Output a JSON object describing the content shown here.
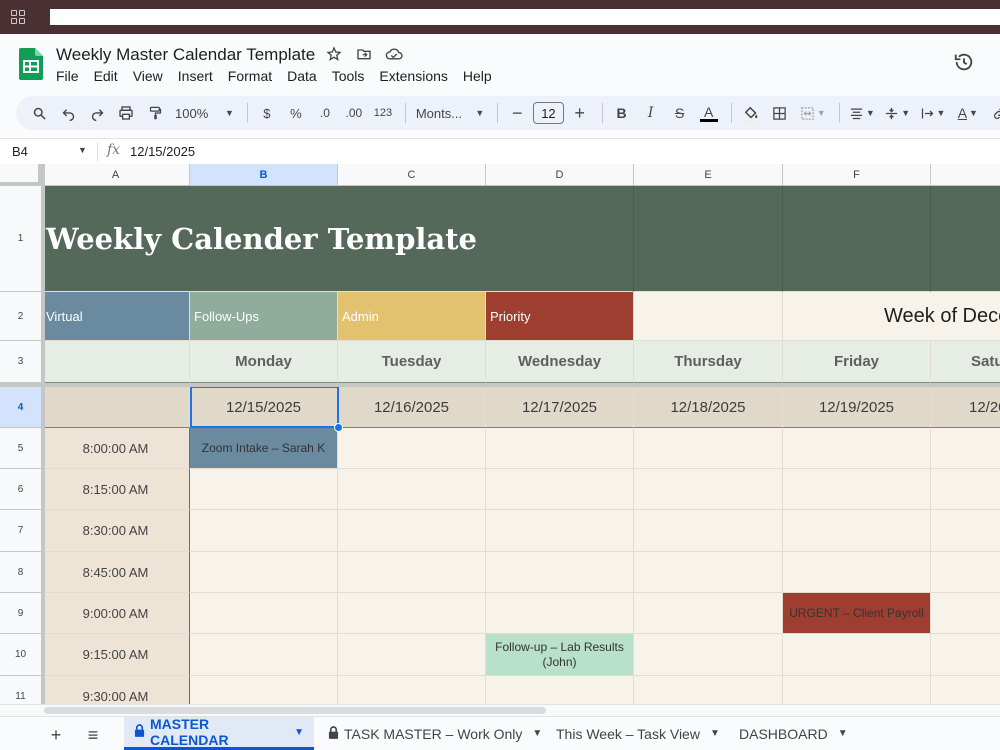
{
  "app": {
    "title": "Weekly Master Calendar Template",
    "menu": [
      "File",
      "Edit",
      "View",
      "Insert",
      "Format",
      "Data",
      "Tools",
      "Extensions",
      "Help"
    ]
  },
  "toolbar": {
    "zoom": "100%",
    "currency": "$",
    "percent": "%",
    "dec_decrease": ".0",
    "dec_increase": ".00",
    "number_format": "123",
    "font": "Monts...",
    "font_size": "12",
    "bold": "B",
    "italic": "I",
    "text_color": "A"
  },
  "formula_bar": {
    "cell_ref": "B4",
    "fx": "fx",
    "value": "12/15/2025"
  },
  "sheet": {
    "columns": [
      "A",
      "B",
      "C",
      "D",
      "E",
      "F"
    ],
    "rows": [
      "1",
      "2",
      "3",
      "4",
      "5",
      "6",
      "7",
      "8",
      "9",
      "10",
      "11"
    ],
    "title": "Weekly Calender Template",
    "legend": [
      "Virtual",
      "Follow-Ups",
      "Admin",
      "Priority"
    ],
    "week_of": "Week of Dece",
    "days": [
      "Monday",
      "Tuesday",
      "Wednesday",
      "Thursday",
      "Friday",
      "Satu"
    ],
    "dates": [
      "12/15/2025",
      "12/16/2025",
      "12/17/2025",
      "12/18/2025",
      "12/19/2025",
      "12/20"
    ],
    "times": [
      "8:00:00 AM",
      "8:15:00 AM",
      "8:30:00 AM",
      "8:45:00 AM",
      "9:00:00 AM",
      "9:15:00 AM",
      "9:30:00 AM"
    ],
    "events": {
      "zoom_intake": "Zoom Intake – Sarah K",
      "urgent": "URGENT – Client Payroll",
      "follow_up": "Follow-up – Lab Results (John)"
    }
  },
  "tabs": [
    {
      "label": "MASTER CALENDAR",
      "locked": true,
      "active": true
    },
    {
      "label": "TASK MASTER – Work Only",
      "locked": true,
      "active": false
    },
    {
      "label": "This Week – Task View",
      "locked": false,
      "active": false
    },
    {
      "label": "DASHBOARD",
      "locked": false,
      "active": false
    }
  ],
  "colors": {
    "title_bg": "#55695a",
    "virtual": "#6a8aa0",
    "follow_ups": "#8fac9c",
    "admin": "#e2c26e",
    "priority": "#9d3e31",
    "follow_up_event": "#b8e0ca",
    "selection": "#1a73e8"
  }
}
